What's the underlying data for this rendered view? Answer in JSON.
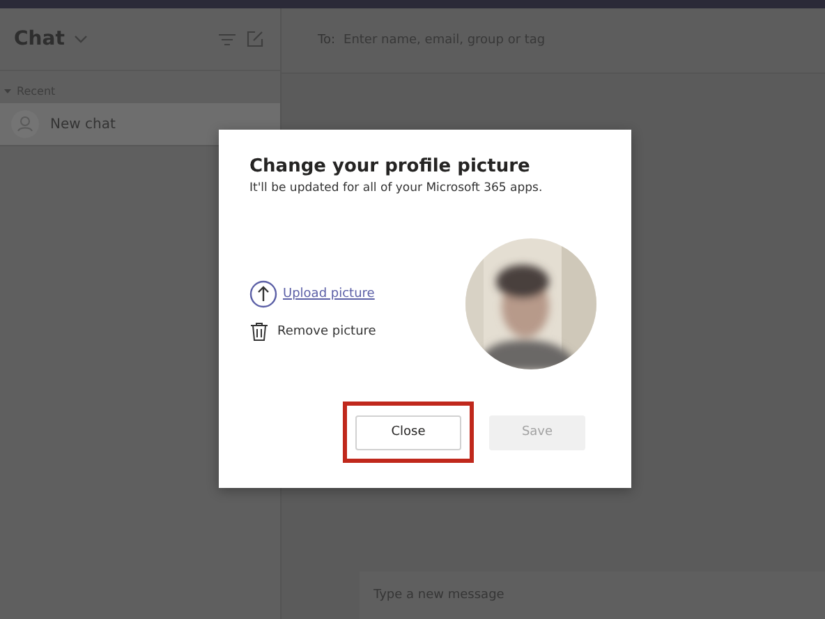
{
  "sidebar": {
    "title": "Chat",
    "section": {
      "label": "Recent",
      "expanded": true
    },
    "items": [
      {
        "label": "New chat",
        "selected": true
      }
    ]
  },
  "compose": {
    "to_label": "To:",
    "to_placeholder": "Enter name, email, group or tag",
    "message_placeholder": "Type a new message"
  },
  "dialog": {
    "title": "Change your profile picture",
    "subtitle": "It'll be updated for all of your Microsoft 365 apps.",
    "actions": [
      {
        "kind": "upload",
        "label": "Upload picture"
      },
      {
        "kind": "remove",
        "label": "Remove picture"
      }
    ],
    "buttons": [
      {
        "label": "Close",
        "disabled": false,
        "highlighted": true
      },
      {
        "label": "Save",
        "disabled": true,
        "highlighted": false
      }
    ]
  }
}
